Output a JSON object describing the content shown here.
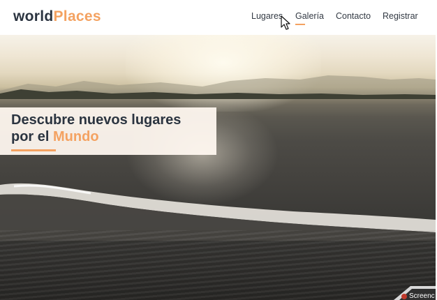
{
  "header": {
    "logo": {
      "part1": "world",
      "part2": "Places"
    },
    "nav": [
      {
        "label": "Lugares"
      },
      {
        "label": "Galería"
      },
      {
        "label": "Contacto"
      },
      {
        "label": "Registrar"
      }
    ]
  },
  "hero": {
    "title_line1": "Descubre nuevos lugares",
    "title_line2_prefix": "por el",
    "title_line2_accent": "Mundo"
  },
  "watermark": {
    "label": "Screenc"
  },
  "colors": {
    "accent": "#f4a261",
    "text_dark": "#2b3440",
    "nav_text": "#333a44"
  }
}
